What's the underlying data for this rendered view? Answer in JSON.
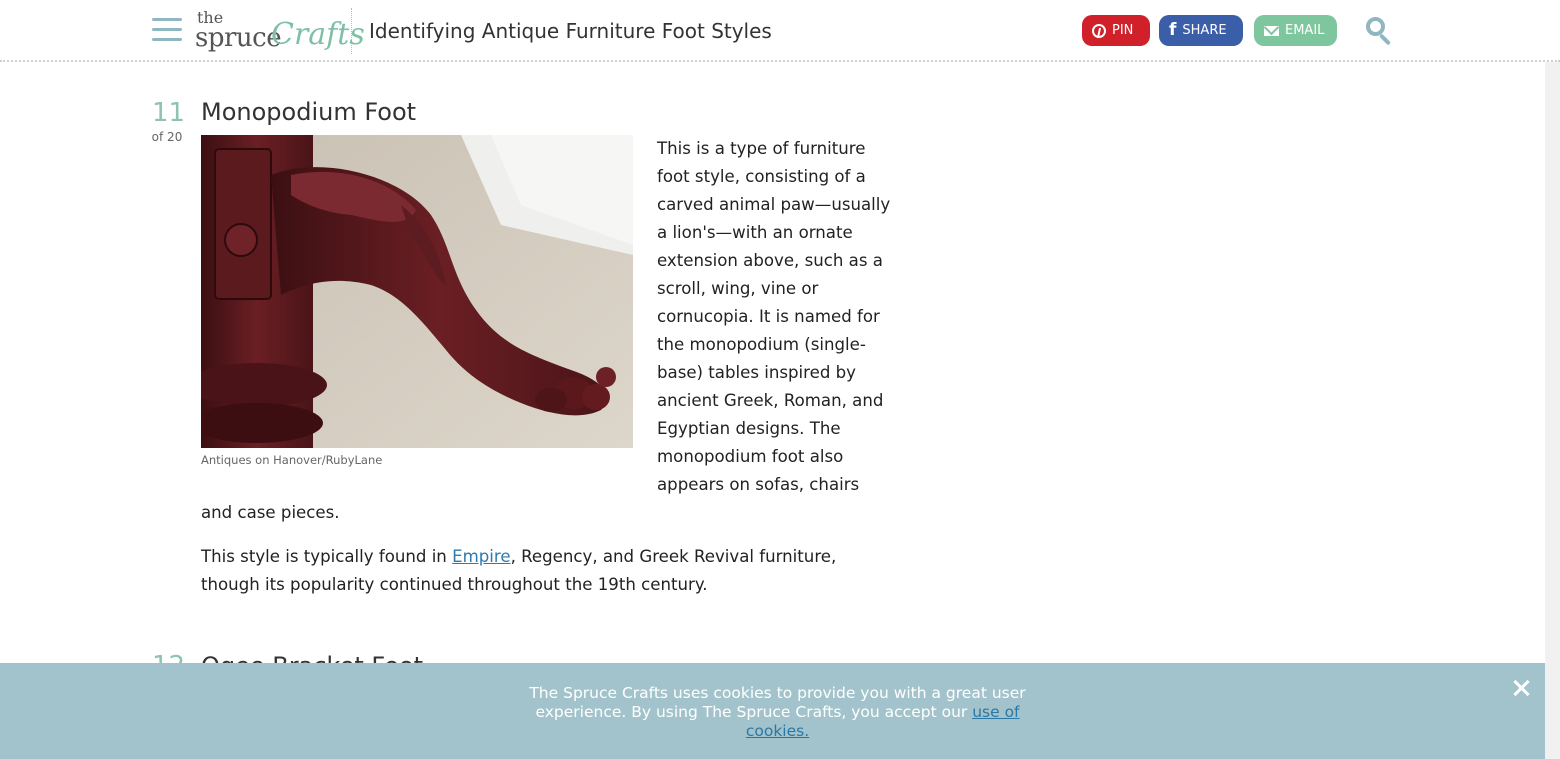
{
  "header": {
    "logo": {
      "the": "the",
      "spruce": "spruce",
      "crafts": "Crafts"
    },
    "title": "Identifying Antique Furniture Foot Styles",
    "share": {
      "pin_label": "PIN",
      "facebook_label": "SHARE",
      "email_label": "EMAIL"
    },
    "icons": [
      "menu-icon",
      "search-icon",
      "pinterest-icon",
      "facebook-icon",
      "email-icon"
    ]
  },
  "step": {
    "number": "11",
    "of": "of 20",
    "title": "Monopodium Foot",
    "image_caption": "Antiques on Hanover/RubyLane",
    "paragraph1": "This is a type of furniture foot style, consisting of a carved animal paw—usually a lion's—with an ornate extension above, such as a scroll, wing, vine or cornucopia. It is named for the monopodium (single-base) tables inspired by ancient Greek, Roman, and Egyptian designs. The monopodium foot also appears on sofas, chairs and case pieces.",
    "paragraph2_before": "This style is typically found in ",
    "paragraph2_link": "Empire",
    "paragraph2_after": ", Regency, and Greek Revival furniture, though its popularity continued throughout the 19th century."
  },
  "next_step": {
    "number": "12",
    "title": "Ogee Bracket Foot"
  },
  "cookie_banner": {
    "text": "The Spruce Crafts uses cookies to provide you with a great user experience. By using The Spruce Crafts, you accept our ",
    "link": "use of cookies."
  },
  "colors": {
    "accent": "#8ec3b0",
    "pin": "#d0202a",
    "facebook": "#3b5ea8",
    "email": "#7ec79e",
    "cookie_bg": "#a3c3cc",
    "link": "#2b7bb0"
  }
}
